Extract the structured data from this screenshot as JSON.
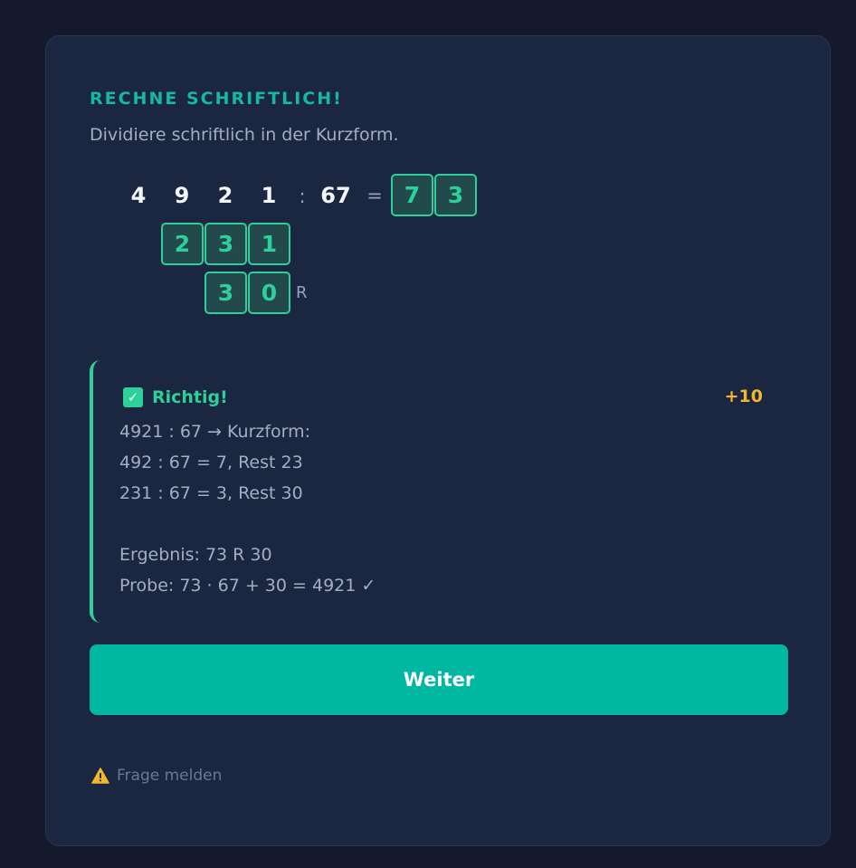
{
  "header": {
    "kicker": "RECHNE SCHRIFTLICH!",
    "instruction": "Dividiere schriftlich in der Kurzform."
  },
  "problem": {
    "dividend_digits": [
      "4",
      "9",
      "2",
      "1"
    ],
    "divide_sign": ":",
    "divisor": "67",
    "equals_sign": "=",
    "quotient_inputs": [
      "7",
      "3"
    ],
    "step_inputs": [
      "2",
      "3",
      "1"
    ],
    "remainder_inputs": [
      "3",
      "0"
    ],
    "remainder_suffix": "R"
  },
  "feedback": {
    "icon": "check-mark-icon",
    "title": "Richtig!",
    "points": "+10",
    "lines": [
      "4921 : 67 → Kurzform:",
      "492 : 67 = 7, Rest 23",
      "231 : 67 = 3, Rest 30",
      "",
      "Ergebnis: 73 R 30",
      "Probe: 73 · 67 + 30 = 4921 ✓"
    ]
  },
  "actions": {
    "continue_label": "Weiter",
    "report_label": "Frage melden",
    "report_icon": "warning-icon"
  },
  "colors": {
    "background": "#141a2b",
    "card": "#1b2640",
    "accent": "#00b8a1",
    "correct": "#2ed09a",
    "points": "#f2b72d",
    "warning": "#f2b72d"
  }
}
